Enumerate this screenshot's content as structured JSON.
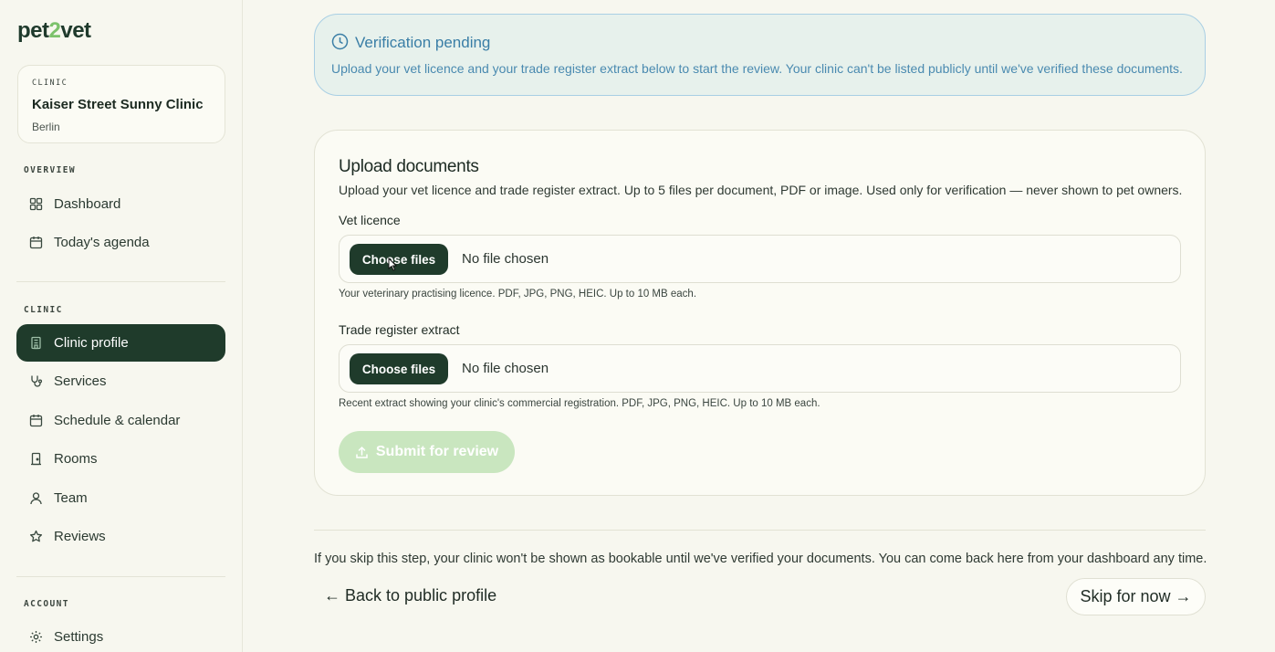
{
  "brand": {
    "logo_a": "pet",
    "logo_b": "2",
    "logo_c": "vet"
  },
  "clinic_card": {
    "label": "CLINIC",
    "name": "Kaiser Street Sunny Clinic",
    "city": "Berlin"
  },
  "sidebar": {
    "overview_label": "OVERVIEW",
    "clinic_label": "CLINIC",
    "account_label": "ACCOUNT",
    "items": {
      "dashboard": "Dashboard",
      "agenda": "Today's agenda",
      "clinic_profile": "Clinic profile",
      "services": "Services",
      "schedule": "Schedule & calendar",
      "rooms": "Rooms",
      "team": "Team",
      "reviews": "Reviews",
      "settings": "Settings"
    }
  },
  "banner": {
    "title": "Verification pending",
    "description": "Upload your vet licence and your trade register extract below to start the review. Your clinic can't be listed publicly until we've verified these documents."
  },
  "upload": {
    "title": "Upload documents",
    "subtitle": "Upload your vet licence and trade register extract. Up to 5 files per document, PDF or image. Used only for verification — never shown to pet owners.",
    "vet_licence": {
      "label": "Vet licence",
      "button": "Choose files",
      "status": "No file chosen",
      "hint": "Your veterinary practising licence. PDF, JPG, PNG, HEIC. Up to 10 MB each."
    },
    "trade_register": {
      "label": "Trade register extract",
      "button": "Choose files",
      "status": "No file chosen",
      "hint": "Recent extract showing your clinic's commercial registration. PDF, JPG, PNG, HEIC. Up to 10 MB each."
    },
    "submit": "Submit for review"
  },
  "footer": {
    "note": "If you skip this step, your clinic won't be shown as bookable until we've verified your documents. You can come back here from your dashboard any time.",
    "back": "← Back to public profile",
    "skip": "Skip for now →"
  },
  "colors": {
    "accent_dark_green": "#1f3b2b",
    "brand_light_green": "#7cc26b",
    "info_blue": "#3a7ea6",
    "disabled_green": "#c9e6bf"
  }
}
